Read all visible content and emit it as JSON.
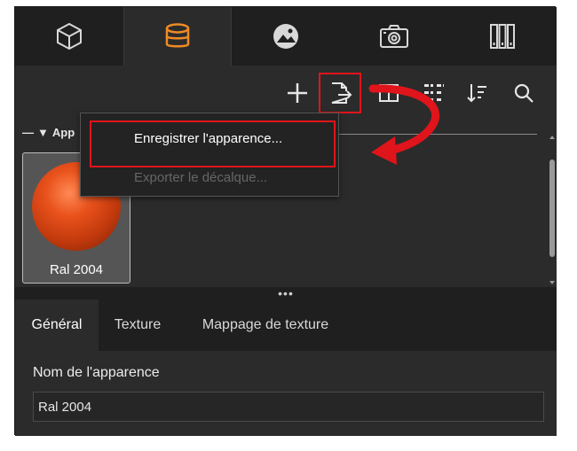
{
  "top_tabs": [
    {
      "icon": "cube-icon"
    },
    {
      "icon": "database-icon",
      "active": true
    },
    {
      "icon": "image-icon"
    },
    {
      "icon": "camera-icon"
    },
    {
      "icon": "library-icon"
    }
  ],
  "toolbar": {
    "buttons": [
      "add-icon",
      "export-file-icon",
      "panel-icon",
      "grid-view-icon",
      "sort-icon",
      "search-icon"
    ]
  },
  "library": {
    "header": "App",
    "swatch_label": "Ral 2004"
  },
  "splitter": "•••",
  "menu": {
    "save": "Enregistrer l'apparence...",
    "export": "Exporter le décalque..."
  },
  "bottom_tabs": [
    "Général",
    "Texture",
    "Mappage de texture"
  ],
  "props": {
    "name_label": "Nom de l'apparence",
    "name_value": "Ral 2004"
  },
  "colors": {
    "accent_orange": "#f08a24",
    "highlight_red": "#e0141b",
    "panel_bg": "#2b2b2b",
    "tab_bg": "#1f1f1f"
  }
}
